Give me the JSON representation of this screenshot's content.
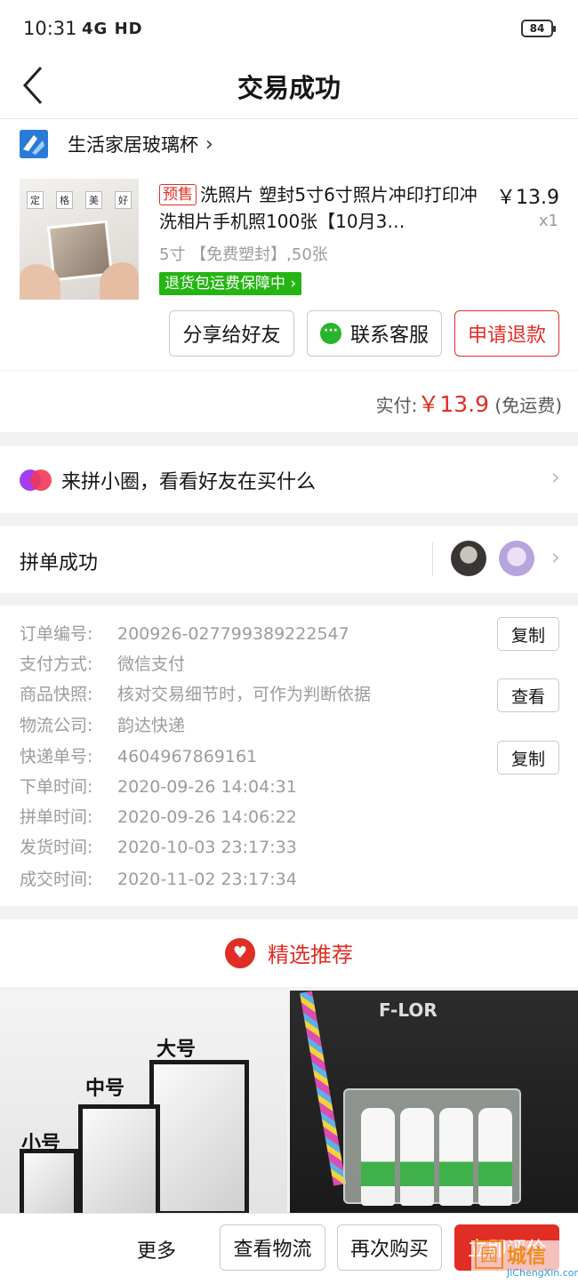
{
  "status_bar": {
    "time": "10:31",
    "network": "4G HD",
    "battery": "84"
  },
  "nav": {
    "title": "交易成功"
  },
  "shop": {
    "name": "生活家居玻璃杯",
    "arrow": "›"
  },
  "product": {
    "presale_tag": "预售",
    "title": "洗照片 塑封5寸6寸照片冲印打印冲洗相片手机照100张【10月3…",
    "price": "￥13.9",
    "quantity": "x1",
    "spec": "5寸 【免费塑封】,50张",
    "guarantee": "退货包运费保障中 ›",
    "image_banner": [
      "定",
      "格",
      "美",
      "好"
    ]
  },
  "actions": {
    "share": "分享给好友",
    "service": "联系客服",
    "refund": "申请退款"
  },
  "payment": {
    "label": "实付:",
    "amount": "￥13.9",
    "note": "(免运费)"
  },
  "circle": {
    "text": "来拼小圈，看看好友在买什么"
  },
  "group": {
    "text": "拼单成功"
  },
  "order_info": {
    "rows": [
      {
        "label": "订单编号:",
        "value": "200926-027799389222547",
        "button": "复制"
      },
      {
        "label": "支付方式:",
        "value": "微信支付"
      },
      {
        "label": "商品快照:",
        "value": "核对交易细节时，可作为判断依据",
        "button": "查看"
      },
      {
        "label": "物流公司:",
        "value": "韵达快递"
      },
      {
        "label": "快递单号:",
        "value": "4604967869161",
        "button": "复制"
      },
      {
        "label": "下单时间:",
        "value": "2020-09-26 14:04:31"
      },
      {
        "label": "拼单时间:",
        "value": "2020-09-26 14:06:22"
      },
      {
        "label": "发货时间:",
        "value": "2020-10-03 23:17:33"
      },
      {
        "label": "成交时间:",
        "value": "2020-11-02 23:17:34"
      }
    ]
  },
  "recommend": {
    "title": "精选推荐",
    "item1_labels": [
      "小号",
      "中号",
      "大号"
    ],
    "item2_text": "F-LOR"
  },
  "bottom_bar": {
    "more": "更多",
    "logistics": "查看物流",
    "rebuy": "再次购买",
    "review": "立即评价"
  },
  "watermark": {
    "logo": "园",
    "text": "城信",
    "sub": "JiChengXin.com"
  },
  "colors": {
    "brand_red": "#e02e24",
    "guarantee_green": "#25b513",
    "wechat_green": "#29b52b"
  }
}
